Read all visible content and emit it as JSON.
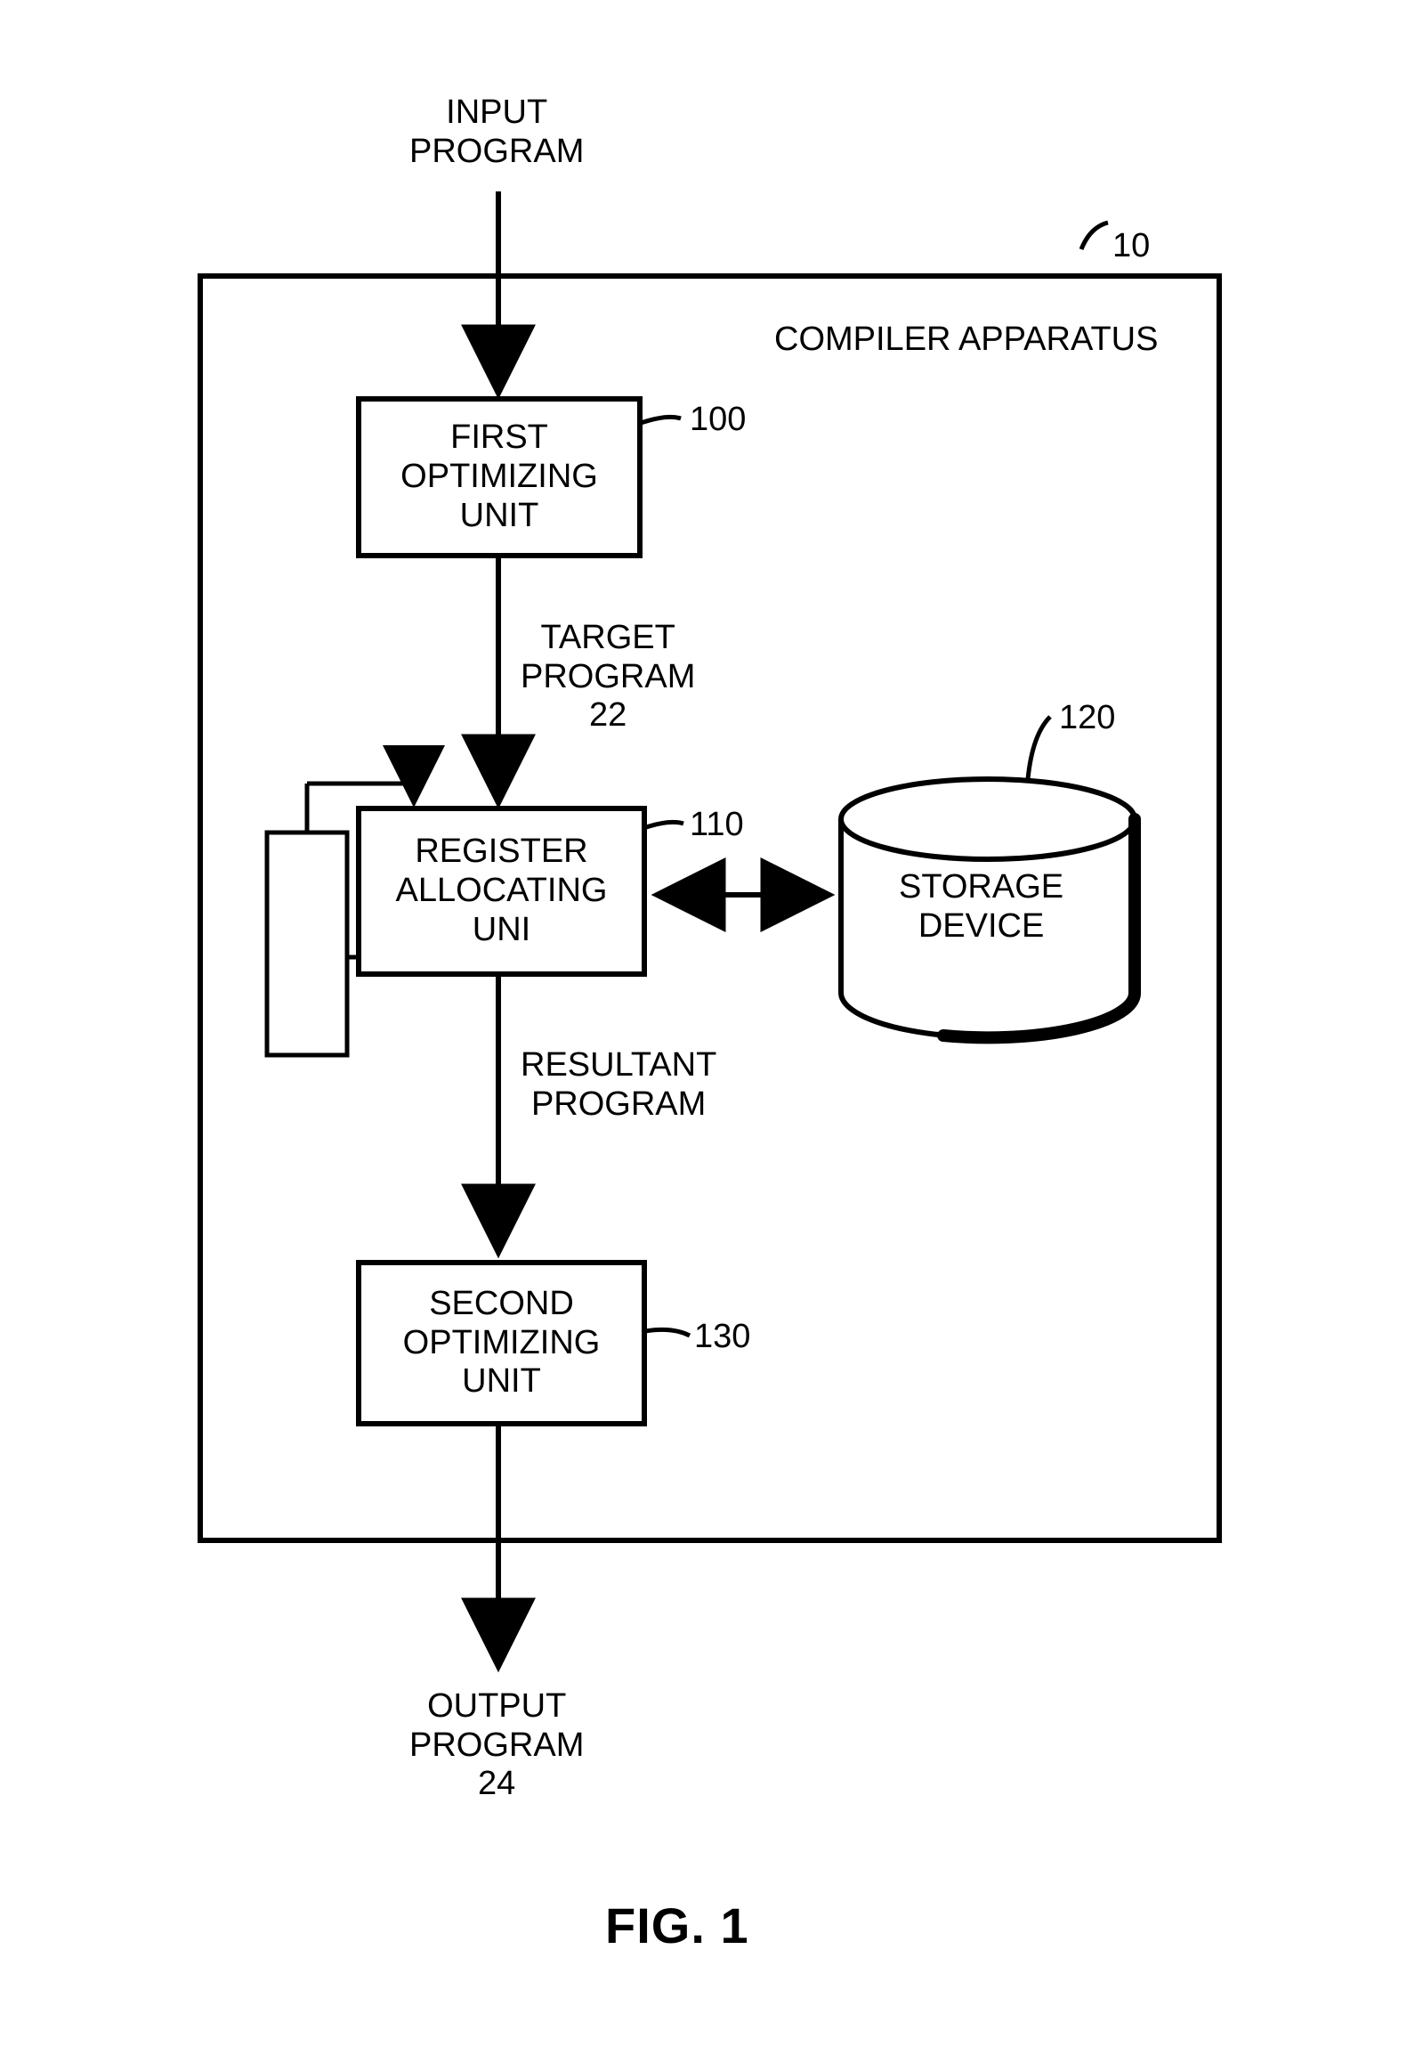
{
  "top_label": "INPUT\nPROGRAM",
  "outer_box": {
    "title": "COMPILER APPARATUS",
    "ref": "10"
  },
  "first_opt": {
    "text": "FIRST\nOPTIMIZING\nUNIT",
    "ref": "100"
  },
  "target_label": "TARGET\nPROGRAM\n22",
  "reg_alloc": {
    "text": "REGISTER\nALLOCATING\nUNI",
    "ref": "110"
  },
  "storage": {
    "text": "STORAGE\nDEVICE",
    "ref": "120"
  },
  "resultant_label": "RESULTANT\nPROGRAM",
  "second_opt": {
    "text": "SECOND\nOPTIMIZING\nUNIT",
    "ref": "130"
  },
  "bottom_label": "OUTPUT\nPROGRAM\n24",
  "figure_title": "FIG. 1"
}
